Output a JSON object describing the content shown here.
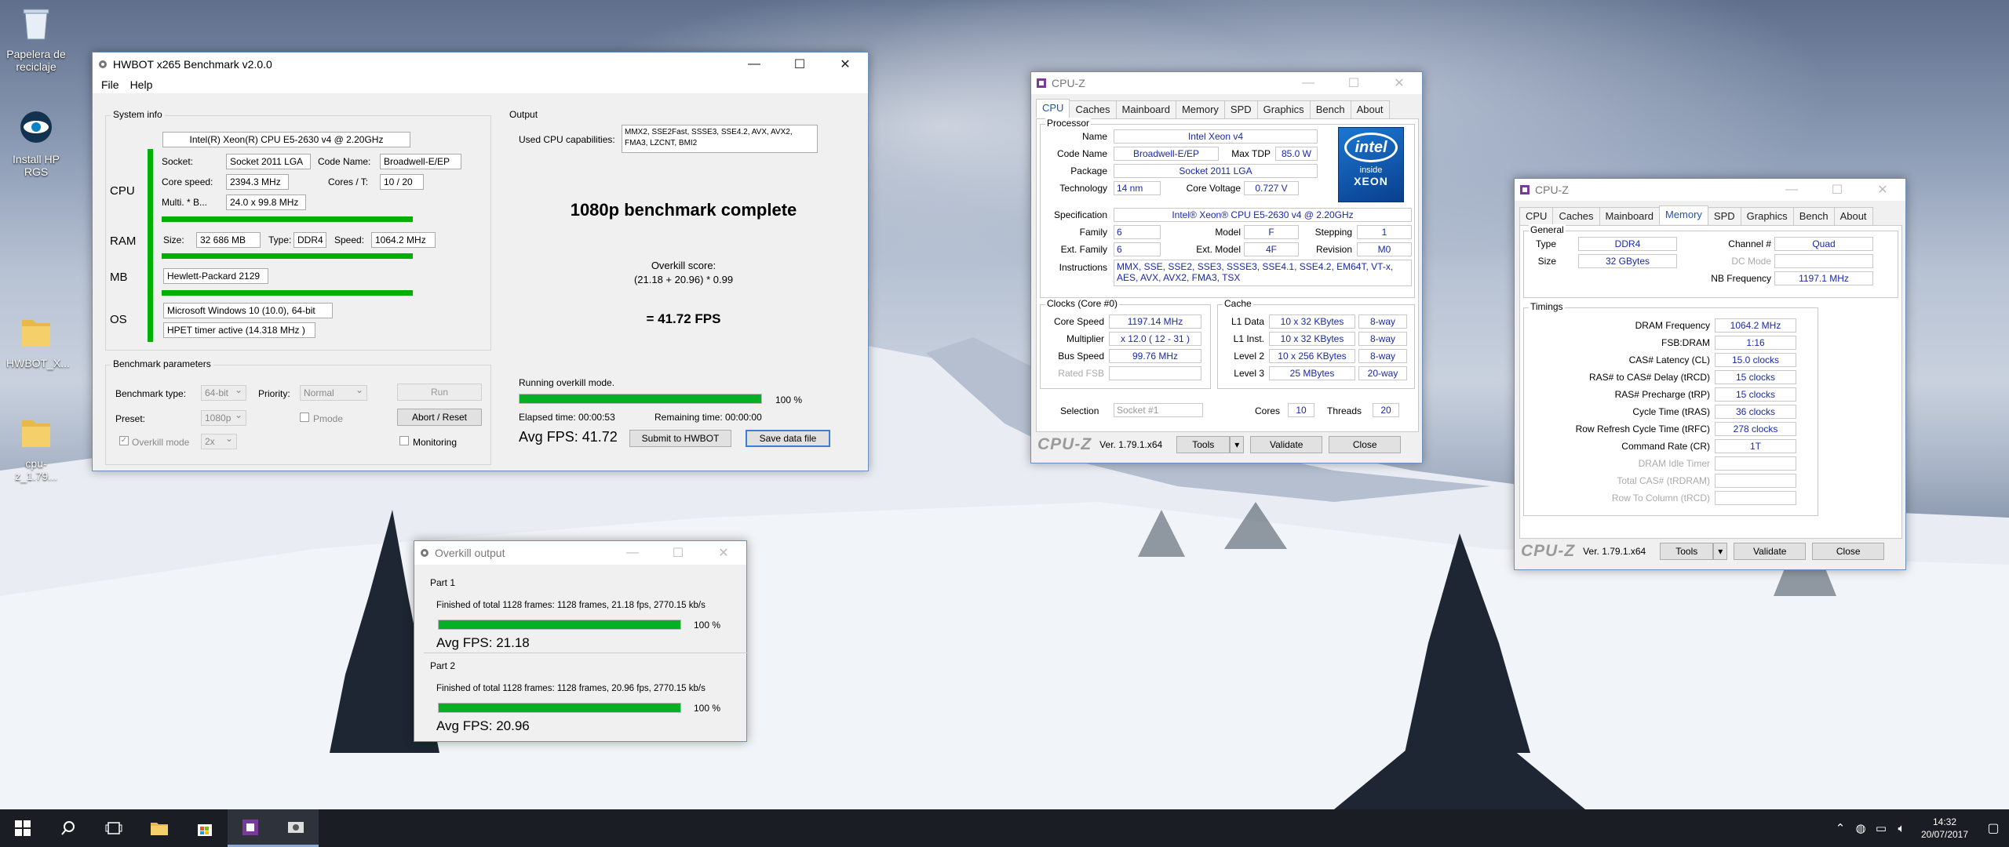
{
  "desktop": {
    "icons": [
      {
        "label": "Papelera de reciclaje",
        "icon": "recycle-bin-icon"
      },
      {
        "label": "Install HP RGS",
        "icon": "hp-rgs-icon"
      },
      {
        "label": "HWBOT_X...",
        "icon": "folder-icon"
      },
      {
        "label": "cpu-z_1.79...",
        "icon": "folder-icon"
      }
    ]
  },
  "hwbot": {
    "title": "HWBOT x265 Benchmark v2.0.0",
    "menu": [
      "File",
      "Help"
    ],
    "system_info": {
      "label": "System info",
      "cpu_name": "Intel(R) Xeon(R) CPU E5-2630 v4 @ 2.20GHz",
      "cpu_label": "CPU",
      "socket_label": "Socket:",
      "socket": "Socket 2011 LGA",
      "codename_label": "Code Name:",
      "codename": "Broadwell-E/EP",
      "corespeed_label": "Core speed:",
      "corespeed": "2394.3 MHz",
      "cores_label": "Cores / T:",
      "cores": "10 / 20",
      "multi_label": "Multi. * B...",
      "multi": "24.0 x 99.8 MHz",
      "ram_label": "RAM",
      "size_label": "Size:",
      "size": "32 686 MB",
      "type_label": "Type:",
      "type": "DDR4",
      "speed_label": "Speed:",
      "speed": "1064.2 MHz",
      "mb_label": "MB",
      "mb": "Hewlett-Packard 2129",
      "os_label": "OS",
      "os": "Microsoft Windows 10 (10.0), 64-bit",
      "timer": "HPET timer active (14.318 MHz )"
    },
    "params": {
      "label": "Benchmark parameters",
      "type_label": "Benchmark type:",
      "type": "64-bit",
      "priority_label": "Priority:",
      "priority": "Normal",
      "run": "Run",
      "preset_label": "Preset:",
      "preset": "1080p",
      "pmode": "Pmode",
      "abort": "Abort / Reset",
      "overkill_label": "Overkill mode",
      "overkill": "2x",
      "monitoring": "Monitoring"
    },
    "output": {
      "label": "Output",
      "caps_label": "Used CPU capabilities:",
      "caps": "MMX2, SSE2Fast, SSSE3, SSE4.2, AVX, AVX2, FMA3, LZCNT, BMI2",
      "headline": "1080p benchmark complete",
      "score_label": "Overkill score:",
      "formula": "(21.18 + 20.96) * 0.99",
      "result": "= 41.72 FPS",
      "status": "Running overkill mode.",
      "progress": 100,
      "progress_text": "100 %",
      "elapsed": "Elapsed time: 00:00:53",
      "remaining": "Remaining time: 00:00:00",
      "avg": "Avg FPS: 41.72",
      "submit": "Submit to HWBOT",
      "save": "Save data file"
    }
  },
  "overkill": {
    "title": "Overkill output",
    "parts": [
      {
        "label": "Part 1",
        "line": "Finished of total 1128 frames: 1128 frames, 21.18 fps,   2770.15 kb/s",
        "progress": 100,
        "progress_text": "100 %",
        "avg": "Avg FPS: 21.18"
      },
      {
        "label": "Part 2",
        "line": "Finished of total 1128 frames: 1128 frames, 20.96 fps,   2770.15 kb/s",
        "progress": 100,
        "progress_text": "100 %",
        "avg": "Avg FPS: 20.96"
      }
    ]
  },
  "cpuz1": {
    "title": "CPU-Z",
    "tabs": [
      "CPU",
      "Caches",
      "Mainboard",
      "Memory",
      "SPD",
      "Graphics",
      "Bench",
      "About"
    ],
    "active_tab": "CPU",
    "processor": {
      "label": "Processor",
      "name_label": "Name",
      "name": "Intel Xeon v4",
      "codename_label": "Code Name",
      "codename": "Broadwell-E/EP",
      "tdp_label": "Max TDP",
      "tdp": "85.0 W",
      "package_label": "Package",
      "package": "Socket 2011 LGA",
      "tech_label": "Technology",
      "tech": "14 nm",
      "voltage_label": "Core Voltage",
      "voltage": "0.727 V",
      "spec_label": "Specification",
      "spec": "Intel® Xeon® CPU E5-2630 v4 @ 2.20GHz",
      "family_label": "Family",
      "family": "6",
      "model_label": "Model",
      "model": "F",
      "stepping_label": "Stepping",
      "stepping": "1",
      "extfamily_label": "Ext. Family",
      "extfamily": "6",
      "extmodel_label": "Ext. Model",
      "extmodel": "4F",
      "revision_label": "Revision",
      "revision": "M0",
      "instr_label": "Instructions",
      "instr": "MMX, SSE, SSE2, SSE3, SSSE3, SSE4.1, SSE4.2, EM64T, VT-x, AES, AVX, AVX2, FMA3, TSX",
      "logo_brand": "intel",
      "logo_inside": "inside",
      "logo_product": "XEON"
    },
    "clocks": {
      "label": "Clocks (Core #0)",
      "corespeed_label": "Core Speed",
      "corespeed": "1197.14 MHz",
      "multi_label": "Multiplier",
      "multi": "x 12.0 ( 12 - 31 )",
      "bus_label": "Bus Speed",
      "bus": "99.76 MHz",
      "fsb_label": "Rated FSB",
      "fsb": ""
    },
    "cache": {
      "label": "Cache",
      "rows": [
        {
          "name": "L1 Data",
          "size": "10 x 32 KBytes",
          "way": "8-way"
        },
        {
          "name": "L1 Inst.",
          "size": "10 x 32 KBytes",
          "way": "8-way"
        },
        {
          "name": "Level 2",
          "size": "10 x 256 KBytes",
          "way": "8-way"
        },
        {
          "name": "Level 3",
          "size": "25 MBytes",
          "way": "20-way"
        }
      ]
    },
    "selection_label": "Selection",
    "selection": "Socket #1",
    "cores_label": "Cores",
    "cores": "10",
    "threads_label": "Threads",
    "threads": "20",
    "logo": "CPU-Z",
    "version": "Ver. 1.79.1.x64",
    "tools": "Tools",
    "validate": "Validate",
    "close": "Close"
  },
  "cpuz2": {
    "title": "CPU-Z",
    "tabs": [
      "CPU",
      "Caches",
      "Mainboard",
      "Memory",
      "SPD",
      "Graphics",
      "Bench",
      "About"
    ],
    "active_tab": "Memory",
    "general": {
      "label": "General",
      "type_label": "Type",
      "type": "DDR4",
      "channel_label": "Channel #",
      "channel": "Quad",
      "size_label": "Size",
      "size": "32 GBytes",
      "dcmode_label": "DC Mode",
      "dcmode": "",
      "nb_label": "NB Frequency",
      "nb": "1197.1 MHz"
    },
    "timings": {
      "label": "Timings",
      "rows": [
        {
          "label": "DRAM Frequency",
          "value": "1064.2 MHz",
          "grey": false
        },
        {
          "label": "FSB:DRAM",
          "value": "1:16",
          "grey": false
        },
        {
          "label": "CAS# Latency (CL)",
          "value": "15.0 clocks",
          "grey": false
        },
        {
          "label": "RAS# to CAS# Delay (tRCD)",
          "value": "15 clocks",
          "grey": false
        },
        {
          "label": "RAS# Precharge (tRP)",
          "value": "15 clocks",
          "grey": false
        },
        {
          "label": "Cycle Time (tRAS)",
          "value": "36 clocks",
          "grey": false
        },
        {
          "label": "Row Refresh Cycle Time (tRFC)",
          "value": "278 clocks",
          "grey": false
        },
        {
          "label": "Command Rate (CR)",
          "value": "1T",
          "grey": false
        },
        {
          "label": "DRAM Idle Timer",
          "value": "",
          "grey": true
        },
        {
          "label": "Total CAS# (tRDRAM)",
          "value": "",
          "grey": true
        },
        {
          "label": "Row To Column (tRCD)",
          "value": "",
          "grey": true
        }
      ]
    },
    "logo": "CPU-Z",
    "version": "Ver. 1.79.1.x64",
    "tools": "Tools",
    "validate": "Validate",
    "close": "Close"
  },
  "taskbar": {
    "clock_time": "14:32",
    "clock_date": "20/07/2017"
  },
  "colors": {
    "progress": "#06b025",
    "cpu_bar": "#00b000",
    "taskbar": "#1a1d24",
    "cpuz_value": "#1a2aa8"
  }
}
